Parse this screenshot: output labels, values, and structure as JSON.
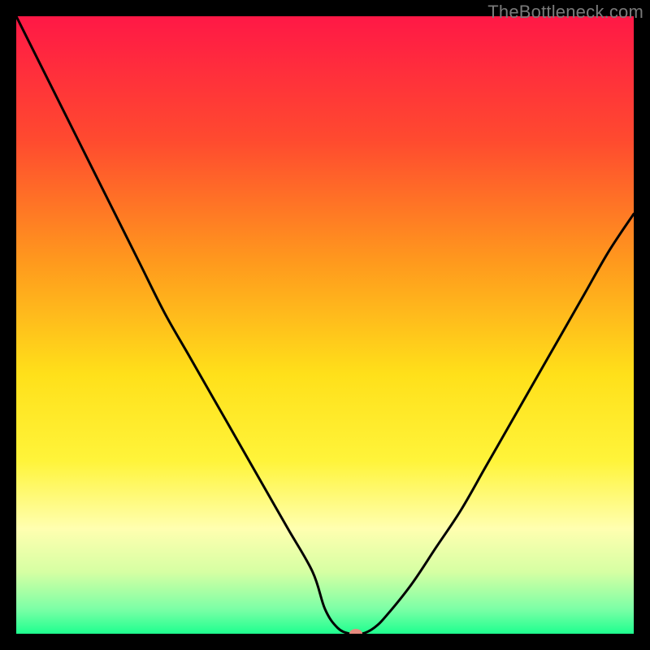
{
  "watermark": "TheBottleneck.com",
  "chart_data": {
    "type": "line",
    "title": "",
    "xlabel": "",
    "ylabel": "",
    "xlim": [
      0,
      100
    ],
    "ylim": [
      0,
      100
    ],
    "grid": false,
    "legend": false,
    "background_gradient_stops": [
      {
        "offset": 0.0,
        "color": "#ff1846"
      },
      {
        "offset": 0.2,
        "color": "#ff4a2f"
      },
      {
        "offset": 0.4,
        "color": "#ff9a1d"
      },
      {
        "offset": 0.58,
        "color": "#ffe01a"
      },
      {
        "offset": 0.72,
        "color": "#fff43a"
      },
      {
        "offset": 0.83,
        "color": "#ffffb0"
      },
      {
        "offset": 0.9,
        "color": "#d6ffa3"
      },
      {
        "offset": 0.96,
        "color": "#7cffa6"
      },
      {
        "offset": 1.0,
        "color": "#1eff8f"
      }
    ],
    "series": [
      {
        "name": "bottleneck-curve",
        "color": "#000000",
        "x": [
          0,
          4,
          8,
          12,
          16,
          20,
          24,
          28,
          32,
          36,
          40,
          44,
          48,
          50,
          52,
          54,
          56,
          58,
          60,
          64,
          68,
          72,
          76,
          80,
          84,
          88,
          92,
          96,
          100
        ],
        "y": [
          100,
          92,
          84,
          76,
          68,
          60,
          52,
          45,
          38,
          31,
          24,
          17,
          10,
          4,
          1,
          0,
          0,
          1,
          3,
          8,
          14,
          20,
          27,
          34,
          41,
          48,
          55,
          62,
          68
        ]
      }
    ],
    "marker": {
      "name": "target-point",
      "x": 55,
      "y": 0,
      "color": "#e58a7e",
      "rx": 8,
      "ry": 6
    }
  }
}
